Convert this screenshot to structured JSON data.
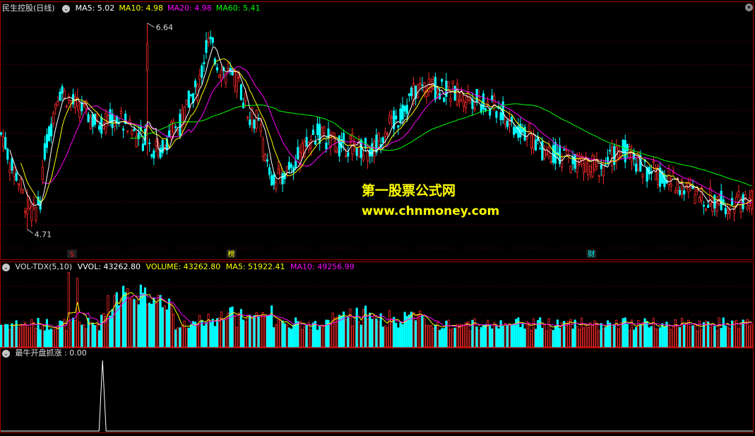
{
  "main_panel": {
    "stock_title": "民生控股(日线)",
    "ma_labels": [
      {
        "name": "MA5",
        "value": "5.02",
        "color": "#ffffff"
      },
      {
        "name": "MA10",
        "value": "4.98",
        "color": "#ffff00"
      },
      {
        "name": "MA20",
        "value": "4.98",
        "color": "#ff00ff"
      },
      {
        "name": "MA60",
        "value": "5.41",
        "color": "#00ff00"
      }
    ],
    "high_label": "6.64",
    "low_label": "4.71",
    "event_markers": [
      {
        "text": "S",
        "bar": 33,
        "color": "#ff2020"
      },
      {
        "text": "榜",
        "bar": 106,
        "color": "#ffff00"
      },
      {
        "text": "财",
        "bar": 271,
        "color": "#00ffff"
      }
    ]
  },
  "volume_panel": {
    "label": "VOL-TDX(5,10)",
    "vvol": "VVOL: 43262.80",
    "volume": "VOLUME: 43262.80",
    "ma5": "MA5: 51922.41",
    "ma10": "MA10: 49256.99"
  },
  "indicator_panel": {
    "label": "最牛开盘抓涨 : 0.00"
  },
  "watermark": {
    "line1": "第一股票公式网",
    "line2": "www.chnmoney.com"
  },
  "colors": {
    "up": "#ff2a2a",
    "down": "#00ffff",
    "ma5": "#ffffff",
    "ma10": "#ffff00",
    "ma20": "#ff00ff",
    "ma60": "#00ff00",
    "grid": "#7a0000",
    "frame": "#a00000"
  },
  "chart_data": {
    "type": "candlestick",
    "bars": 345,
    "y_range": [
      4.6,
      6.75
    ],
    "price_high": 6.64,
    "price_low": 4.71,
    "key_closes": [
      5.6,
      5.25,
      4.95,
      4.85,
      5.0,
      5.55,
      6.0,
      5.85,
      5.7,
      5.75,
      5.55,
      5.45,
      5.65,
      6.0,
      6.45,
      6.2,
      6.1,
      5.75,
      5.15,
      5.35,
      5.6,
      5.5,
      5.5,
      5.45,
      5.7,
      6.05,
      6.0,
      5.95,
      5.85,
      5.65,
      5.45,
      5.35,
      5.3,
      5.45,
      5.25,
      5.15,
      5.0,
      4.96,
      5.0
    ],
    "key_bar_index": [
      0,
      10,
      20,
      25,
      30,
      35,
      45,
      60,
      75,
      90,
      110,
      120,
      135,
      150,
      160,
      170,
      180,
      195,
      210,
      225,
      245,
      260,
      270,
      285,
      300,
      325,
      345,
      360,
      380,
      400,
      420,
      440,
      460,
      480,
      500,
      520,
      540,
      560,
      580
    ],
    "ma_last": {
      "MA5": 5.02,
      "MA10": 4.98,
      "MA20": 4.98,
      "MA60": 5.41
    },
    "volume_last": 43262.8,
    "volume_ma5": 51922.41,
    "volume_ma10": 49256.99,
    "volume_peak": 140000,
    "indicator_value": 0.0,
    "indicator_spike_bar": 47,
    "indicator_spike_value": 1
  }
}
